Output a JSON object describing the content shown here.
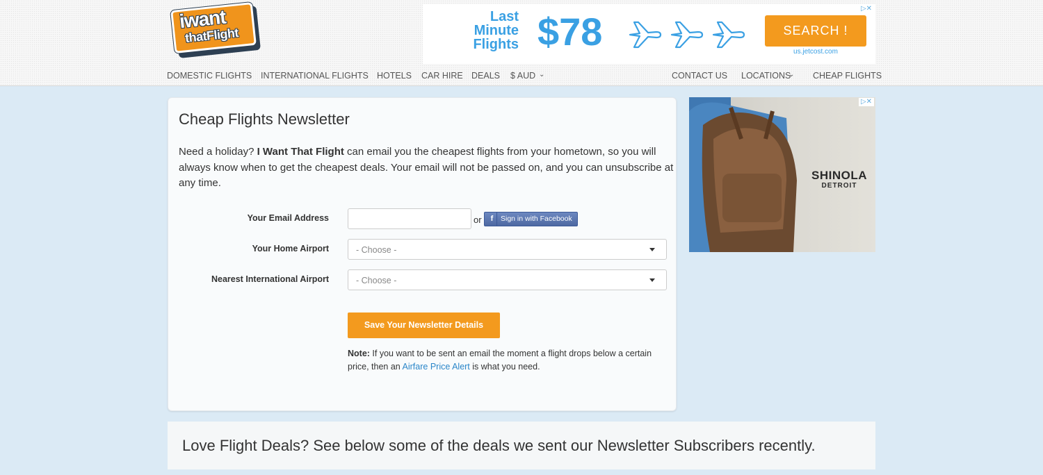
{
  "logo": {
    "line1": "iwant",
    "line2": "thatFlight"
  },
  "ad_top": {
    "headline": "Last Minute Flights",
    "price": "$78",
    "button": "SEARCH !",
    "domain": "us.jetcost.com"
  },
  "nav_left": [
    "DOMESTIC FLIGHTS",
    "INTERNATIONAL FLIGHTS",
    "HOTELS",
    "CAR HIRE",
    "DEALS",
    "$ AUD"
  ],
  "nav_right": [
    "CONTACT US",
    "LOCATIONS",
    "CHEAP FLIGHTS"
  ],
  "main": {
    "title": "Cheap Flights Newsletter",
    "intro_pre": "Need a holiday? ",
    "intro_brand": "I Want That Flight",
    "intro_post": " can email you the cheapest flights from your hometown, so you will always know when to get the cheapest deals. Your email will not be passed on, and you can unsubscribe at any time."
  },
  "form": {
    "email_label": "Your Email Address",
    "email_value": "",
    "or_text": "or",
    "facebook_label": "Sign in with Facebook",
    "home_label": "Your Home Airport",
    "home_value": "- Choose -",
    "intl_label": "Nearest International Airport",
    "intl_value": "- Choose -",
    "save_label": "Save Your Newsletter Details"
  },
  "note": {
    "prefix": "Note:",
    "text1": " If you want to be sent an email the moment a flight drops below a certain price, then an ",
    "link": "Airfare Price Alert",
    "text2": " is what you need."
  },
  "ad_side": {
    "brand": "SHINOLA",
    "city": "DETROIT"
  },
  "banner": {
    "text": "Love Flight Deals? See below some of the deals we sent our Newsletter Subscribers recently."
  },
  "colors": {
    "accent": "#f39a1e",
    "link": "#2a86c9",
    "page_bg": "#dbeaf5"
  }
}
